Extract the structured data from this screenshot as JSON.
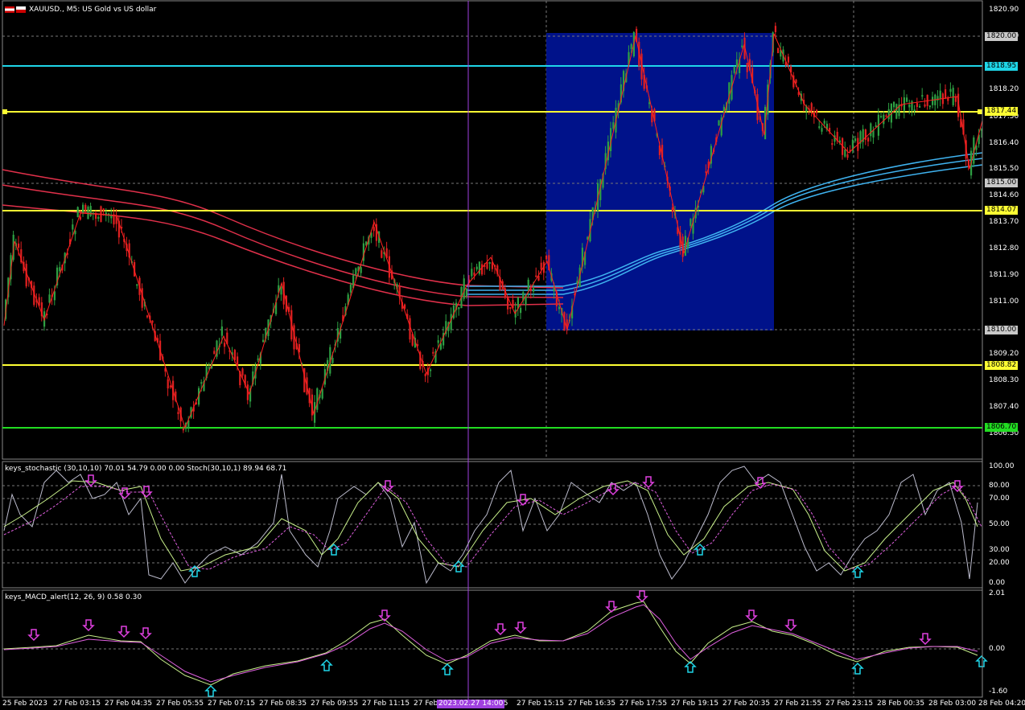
{
  "main": {
    "title": "XAUUSD., M5:  US Gold vs US dollar",
    "y_ticks": [
      "1820.90",
      "1819.20",
      "1818.20",
      "1817.50",
      "1816.40",
      "1815.50",
      "1814.60",
      "1813.70",
      "1812.80",
      "1811.90",
      "1811.00",
      "1809.20",
      "1808.30",
      "1807.40",
      "1806.50"
    ],
    "price_boxes": {
      "p1820": "1820.00",
      "p1818": "1818.95",
      "p1817": "1817.44",
      "p1815": "1815.00",
      "p1814": "1814.07",
      "p1810": "1810.00",
      "p1808": "1808.82",
      "p1806": "1806.70"
    },
    "colors": {
      "background": "#000000",
      "bull": "#2ea043",
      "bear": "#e02020",
      "zone": "#00128a",
      "cyan_level": "#1fd6e8",
      "yellow_level": "#ffff33",
      "green_level": "#22dd22",
      "ma_red": "#e0304a",
      "ma_blue": "#3fb3f0",
      "zigzag": "#ff2020",
      "vline": "#a040e0"
    }
  },
  "stoch": {
    "title": "keys_stochastic (30,10,10) 70.01 54.79 0.00 0.00 Stoch(30,10,1) 89.94 68.71",
    "y_ticks": [
      "100.00",
      "80.00",
      "70.00",
      "50.00",
      "30.00",
      "20.00",
      "0.00"
    ]
  },
  "macd": {
    "title": "keys_MACD_alert(12, 26, 9) 0.58 0.30",
    "y_ticks": [
      "2.01",
      "0.00",
      "-1.60"
    ]
  },
  "time_axis": {
    "labels": [
      "25 Feb 2023",
      "27 Feb 03:15",
      "27 Feb 04:35",
      "27 Feb 05:55",
      "27 Feb 07:15",
      "27 Feb 08:35",
      "27 Feb 09:55",
      "27 Feb 11:15",
      "27 Feb",
      "55",
      "27 Feb 15:15",
      "27 Feb 16:35",
      "27 Feb 17:55",
      "27 Feb 19:15",
      "27 Feb 20:35",
      "27 Feb 21:55",
      "27 Feb 23:15",
      "28 Feb 00:35",
      "28 Feb 03:00",
      "28 Feb 04:20"
    ],
    "cursor_label": "2023.02.27 14:00"
  }
}
